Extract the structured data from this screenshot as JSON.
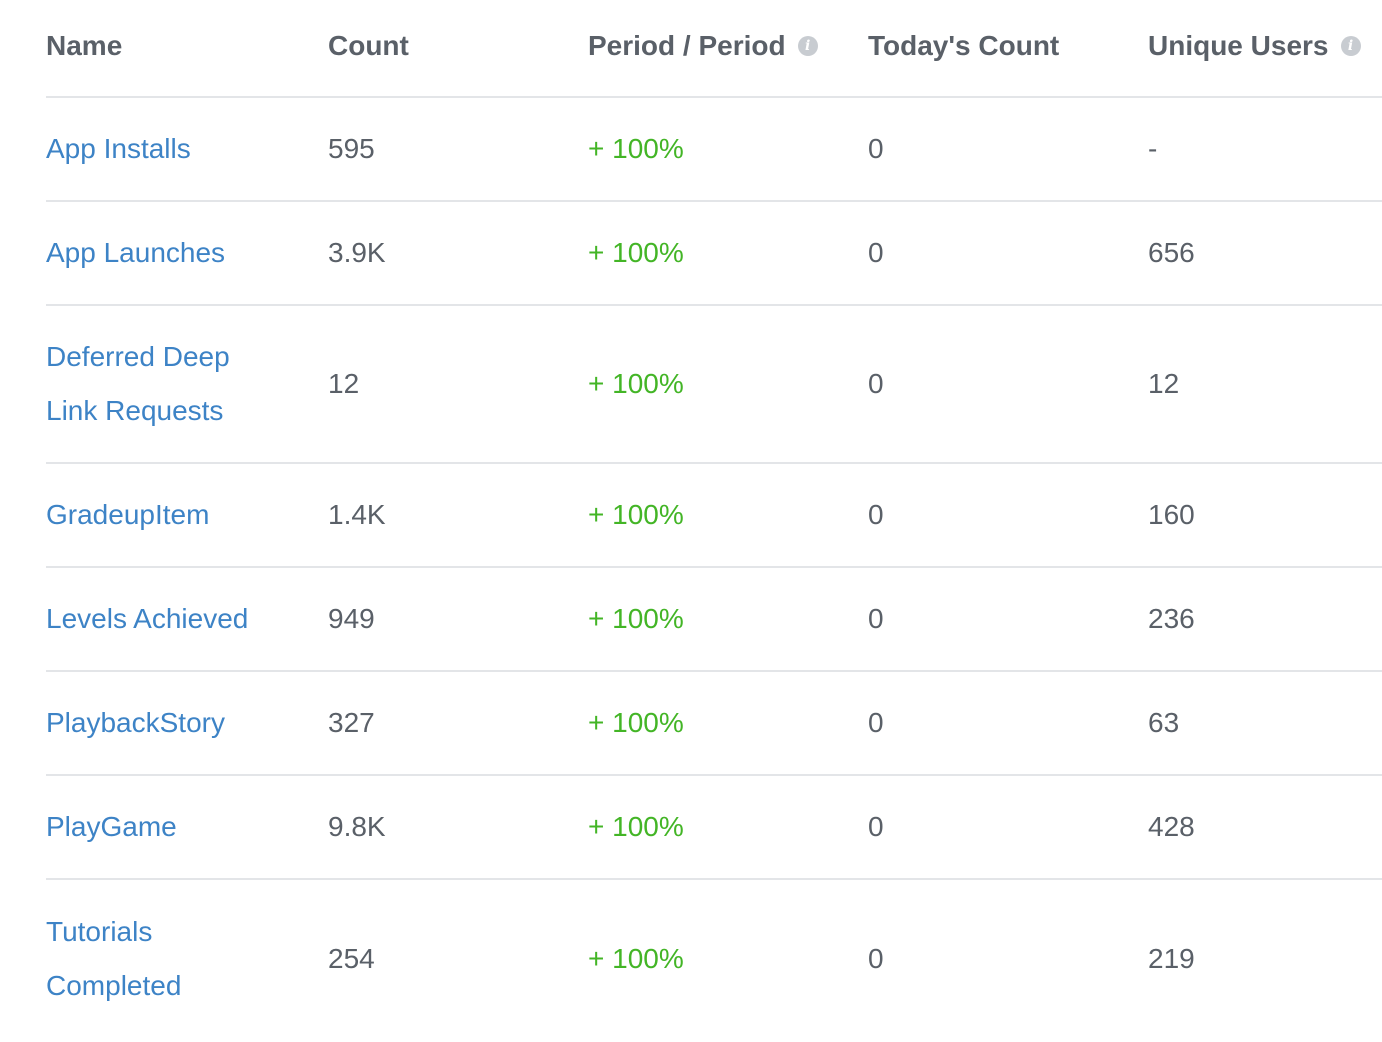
{
  "columns": {
    "name": "Name",
    "count": "Count",
    "period": "Period / Period",
    "today": "Today's Count",
    "unique": "Unique Users"
  },
  "rows": [
    {
      "name": "App Installs",
      "count": "595",
      "period": "+ 100%",
      "today": "0",
      "unique": "-"
    },
    {
      "name": "App Launches",
      "count": "3.9K",
      "period": "+ 100%",
      "today": "0",
      "unique": "656"
    },
    {
      "name": "Deferred Deep Link Requests",
      "count": "12",
      "period": "+ 100%",
      "today": "0",
      "unique": "12"
    },
    {
      "name": "GradeupItem",
      "count": "1.4K",
      "period": "+ 100%",
      "today": "0",
      "unique": "160"
    },
    {
      "name": "Levels Achieved",
      "count": "949",
      "period": "+ 100%",
      "today": "0",
      "unique": "236"
    },
    {
      "name": "PlaybackStory",
      "count": "327",
      "period": "+ 100%",
      "today": "0",
      "unique": "63"
    },
    {
      "name": "PlayGame",
      "count": "9.8K",
      "period": "+ 100%",
      "today": "0",
      "unique": "428"
    },
    {
      "name": "Tutorials Completed",
      "count": "254",
      "period": "+ 100%",
      "today": "0",
      "unique": "219"
    }
  ],
  "icons": {
    "period_info": "info-icon",
    "unique_info": "info-icon"
  },
  "colors": {
    "link": "#3d83c6",
    "positive": "#43b526",
    "text": "#5a6068",
    "divider": "#e3e5e8"
  }
}
